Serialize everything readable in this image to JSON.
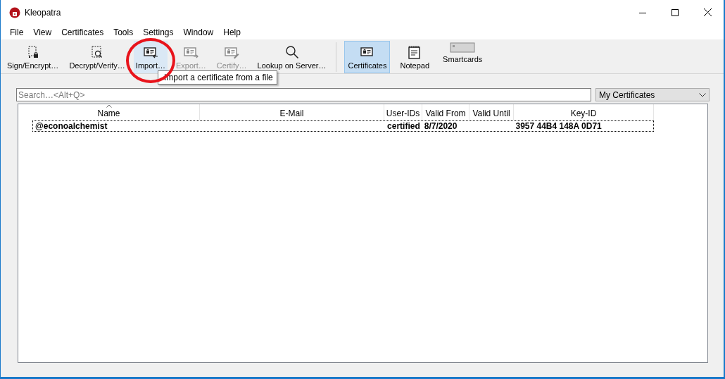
{
  "window": {
    "title": "Kleopatra"
  },
  "menu": [
    "File",
    "View",
    "Certificates",
    "Tools",
    "Settings",
    "Window",
    "Help"
  ],
  "toolbar": [
    {
      "label": "Sign/Encrypt…",
      "disabled": false,
      "hovered": false,
      "circled": false
    },
    {
      "label": "Decrypt/Verify…",
      "disabled": false,
      "hovered": false,
      "circled": false
    },
    {
      "label": "Import…",
      "disabled": false,
      "hovered": true,
      "circled": true
    },
    {
      "label": "Export…",
      "disabled": true,
      "hovered": false,
      "circled": false
    },
    {
      "label": "Certify…",
      "disabled": true,
      "hovered": false,
      "circled": false
    },
    {
      "label": "Lookup on Server…",
      "disabled": false,
      "hovered": false,
      "circled": false
    }
  ],
  "views": [
    {
      "label": "Certificates",
      "selected": true
    },
    {
      "label": "Notepad",
      "selected": false
    },
    {
      "label": "Smartcards",
      "selected": false
    }
  ],
  "tooltip": "Import a certificate from a file",
  "search": {
    "placeholder": "Search…<Alt+Q>"
  },
  "filter": {
    "value": "My Certificates"
  },
  "table": {
    "columns": [
      {
        "label": "Name",
        "sorted": true
      },
      {
        "label": "E-Mail",
        "sorted": false
      },
      {
        "label": "User-IDs",
        "sorted": false
      },
      {
        "label": "Valid From",
        "sorted": false
      },
      {
        "label": "Valid Until",
        "sorted": false
      },
      {
        "label": "Key-ID",
        "sorted": false
      }
    ],
    "rows": [
      {
        "cells": [
          "@econoalchemist",
          "",
          "certified",
          "8/7/2020",
          "",
          "3957 44B4 148A 0D71"
        ],
        "current": true
      }
    ]
  }
}
